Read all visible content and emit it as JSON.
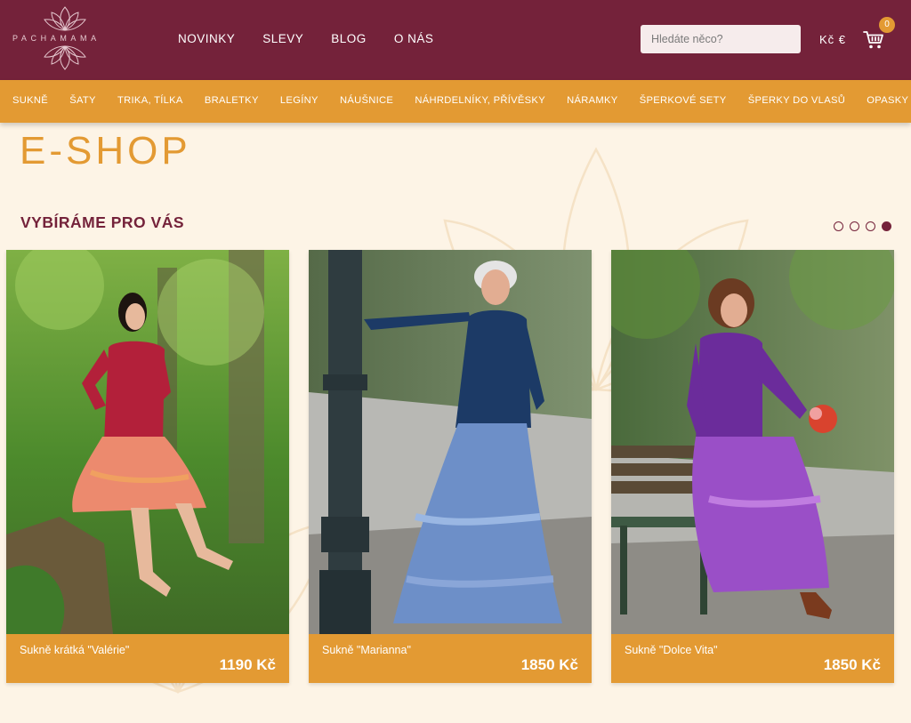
{
  "brand": {
    "logo_text": "PACHAMAMA"
  },
  "main_nav": [
    "NOVINKY",
    "SLEVY",
    "BLOG",
    "O NÁS"
  ],
  "search": {
    "placeholder": "Hledáte něco?"
  },
  "currency_toggle": "Kč  €",
  "cart": {
    "count": "0"
  },
  "categories": [
    "SUKNĚ",
    "ŠATY",
    "TRIKA, TÍLKA",
    "BRALETKY",
    "LEGÍNY",
    "NÁUŠNICE",
    "NÁHRDELNÍKY, PŘÍVĚSKY",
    "NÁRAMKY",
    "ŠPERKOVÉ SETY",
    "ŠPERKY DO VLASŮ",
    "OPASKY"
  ],
  "page_title": "E-SHOP",
  "section_title": "VYBÍRÁME PRO VÁS",
  "carousel": {
    "pages": 4,
    "active_index": 3
  },
  "products": [
    {
      "name": "Sukně krátká \"Valérie\"",
      "price": "1190 Kč"
    },
    {
      "name": "Sukně \"Marianna\"",
      "price": "1850 Kč"
    },
    {
      "name": "Sukně \"Dolce Vita\"",
      "price": "1850 Kč"
    }
  ],
  "colors": {
    "header": "#74223a",
    "accent": "#e39a33",
    "background": "#fdf4e6"
  }
}
